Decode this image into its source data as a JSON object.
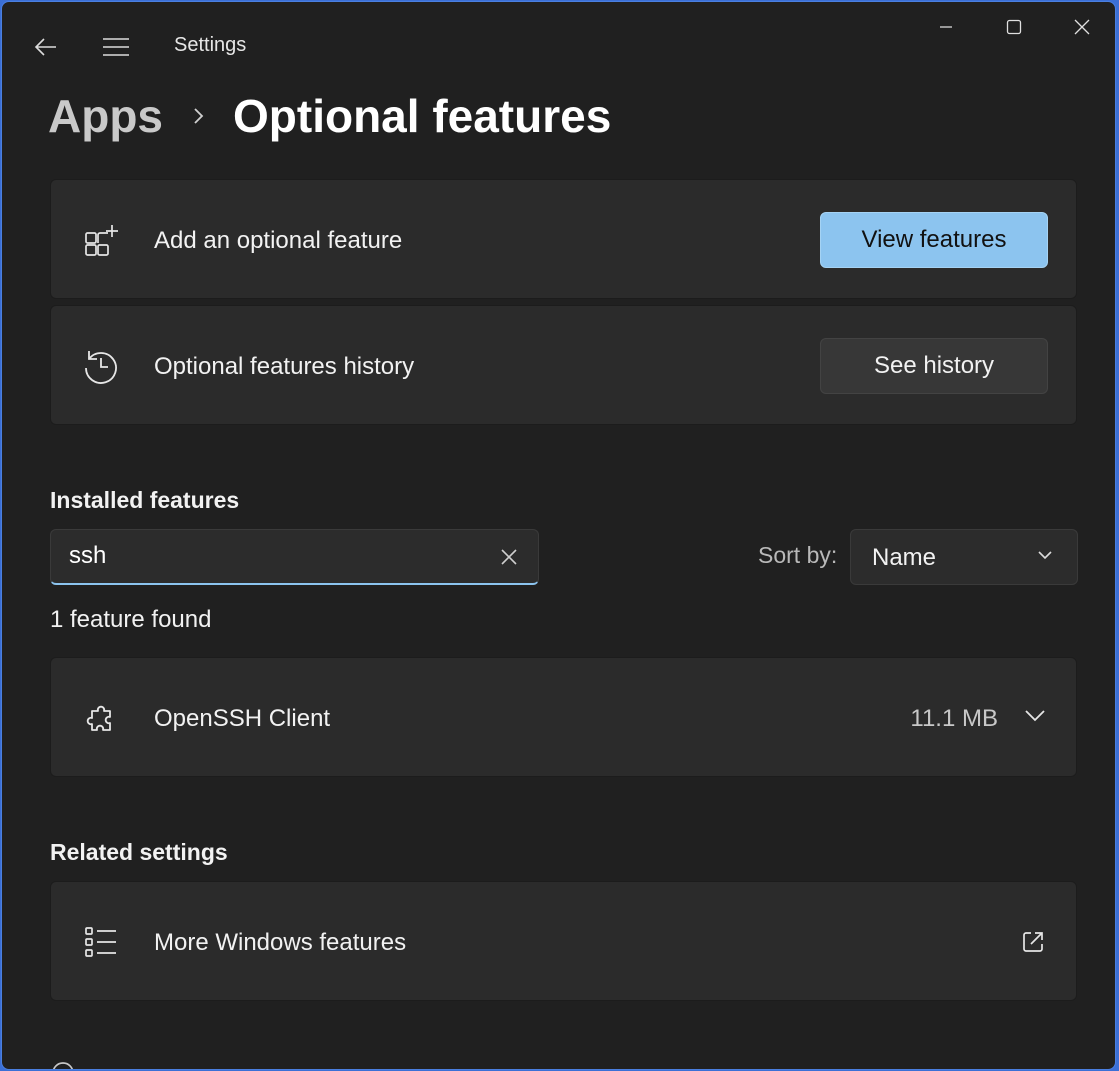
{
  "window": {
    "app_title": "Settings",
    "back_icon": "back-arrow-icon",
    "menu_icon": "hamburger-menu-icon",
    "controls": [
      "minimize-icon",
      "maximize-icon",
      "close-icon"
    ]
  },
  "breadcrumb": {
    "parent": "Apps",
    "current": "Optional features"
  },
  "add_feature": {
    "label": "Add an optional feature",
    "icon": "add-apps-icon",
    "button": "View features"
  },
  "history": {
    "label": "Optional features history",
    "icon": "history-icon",
    "button": "See history"
  },
  "installed": {
    "title": "Installed features",
    "search_value": "ssh",
    "sort_label": "Sort by:",
    "sort_value": "Name",
    "result_count": "1 feature found",
    "items": [
      {
        "name": "OpenSSH Client",
        "size": "11.1 MB",
        "icon": "puzzle-icon"
      }
    ]
  },
  "related": {
    "title": "Related settings",
    "items": [
      {
        "label": "More Windows features",
        "icon": "list-icon"
      }
    ]
  },
  "colors": {
    "accent": "#8cc4ef",
    "background": "#202020",
    "card": "#2b2b2b"
  }
}
